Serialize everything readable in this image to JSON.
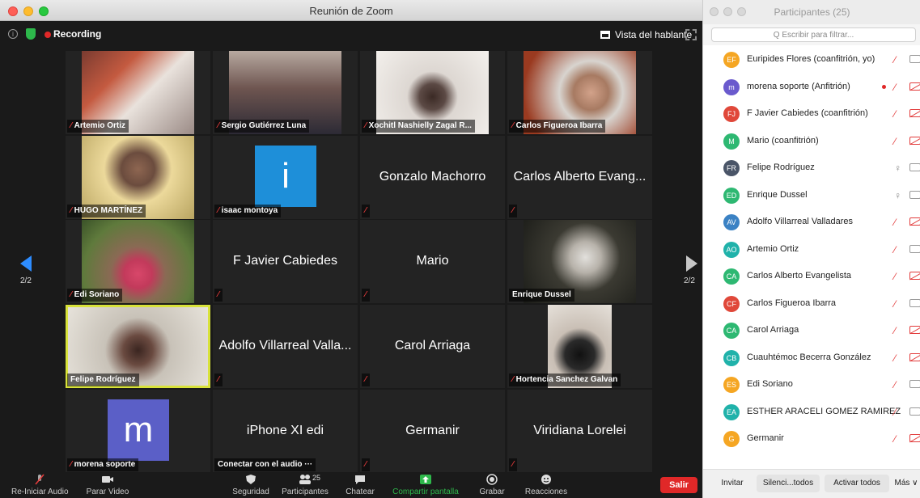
{
  "window": {
    "title": "Reunión de Zoom"
  },
  "topbar": {
    "recording_label": "Recording",
    "view_label": "Vista del hablante"
  },
  "pager": {
    "left": "2/2",
    "right": "2/2"
  },
  "tiles": [
    {
      "name": "Artemio Ortiz"
    },
    {
      "name": "Sergio Gutiérrez Luna"
    },
    {
      "name": "Xochitl Nashielly Zagal R..."
    },
    {
      "name": "Carlos Figueroa Ibarra"
    },
    {
      "name": "HUGO MARTÍNEZ"
    },
    {
      "name": "isaac montoya",
      "avatar_letter": "i"
    },
    {
      "center_name": "Gonzalo Machorro"
    },
    {
      "center_name": "Carlos Alberto Evang..."
    },
    {
      "name": "Edi Soriano"
    },
    {
      "center_name": "F Javier Cabiedes"
    },
    {
      "center_name": "Mario"
    },
    {
      "name": "Enrique Dussel"
    },
    {
      "name": "Felipe Rodríguez"
    },
    {
      "center_name": "Adolfo Villarreal Valla..."
    },
    {
      "center_name": "Carol Arriaga"
    },
    {
      "name": "Hortencia Sanchez Galvan"
    },
    {
      "name": "morena soporte",
      "avatar_letter": "m"
    },
    {
      "center_name": "iPhone XI edi",
      "name": "Conectar con el audio ···"
    },
    {
      "center_name": "Germanir"
    },
    {
      "center_name": "Viridiana Lorelei"
    }
  ],
  "toolbar": {
    "audio": "Re-Iniciar Audio",
    "video": "Parar Video",
    "security": "Seguridad",
    "participants": "Participantes",
    "participants_count": "25",
    "chat": "Chatear",
    "share": "Compartir pantalla",
    "record": "Grabar",
    "reactions": "Reacciones",
    "leave": "Salir"
  },
  "panel": {
    "title": "Participantes (25)",
    "search_placeholder": "Q Escribir para filtrar...",
    "participants": [
      {
        "initials": "EF",
        "name": "Euripides Flores (coanfitrión, yo)",
        "color": "#f5a623",
        "mic": "off",
        "cam": "on"
      },
      {
        "initials": "m",
        "name": "morena soporte (Anfitrión)",
        "color": "#6a5acd",
        "mic": "off",
        "cam": "off",
        "rec": true
      },
      {
        "initials": "FJ",
        "name": "F Javier Cabiedes (coanfitrión)",
        "color": "#e0483a",
        "mic": "off",
        "cam": "off"
      },
      {
        "initials": "M",
        "name": "Mario (coanfitrión)",
        "color": "#2eb872",
        "mic": "off",
        "cam": "off"
      },
      {
        "initials": "FR",
        "name": "Felipe Rodríguez",
        "color": "#4a5568",
        "mic": "on",
        "cam": "on"
      },
      {
        "initials": "ED",
        "name": "Enrique Dussel",
        "color": "#2eb872",
        "mic": "on",
        "cam": "on"
      },
      {
        "initials": "AV",
        "name": "Adolfo Villarreal Valladares",
        "color": "#3b82c4",
        "mic": "off",
        "cam": "off"
      },
      {
        "initials": "AO",
        "name": "Artemio Ortiz",
        "color": "#20b2aa",
        "mic": "off",
        "cam": "on"
      },
      {
        "initials": "CA",
        "name": "Carlos Alberto Evangelista",
        "color": "#2eb872",
        "mic": "off",
        "cam": "off"
      },
      {
        "initials": "CF",
        "name": "Carlos Figueroa Ibarra",
        "color": "#e0483a",
        "mic": "off",
        "cam": "on"
      },
      {
        "initials": "CA",
        "name": "Carol Arriaga",
        "color": "#2eb872",
        "mic": "off",
        "cam": "off"
      },
      {
        "initials": "CB",
        "name": "Cuauhtémoc Becerra González",
        "color": "#20b2aa",
        "mic": "off",
        "cam": "off"
      },
      {
        "initials": "ES",
        "name": "Edi Soriano",
        "color": "#f5a623",
        "mic": "off",
        "cam": "on"
      },
      {
        "initials": "EA",
        "name": "ESTHER ARACELI GOMEZ RAMIREZ",
        "color": "#20b2aa",
        "mic": "off",
        "cam": "on"
      },
      {
        "initials": "G",
        "name": "Germanir",
        "color": "#f5a623",
        "mic": "off",
        "cam": "off"
      }
    ],
    "footer": {
      "invite": "Invitar",
      "mute_all": "Silenci...todos",
      "unmute_all": "Activar todos",
      "more": "Más ∨"
    }
  }
}
